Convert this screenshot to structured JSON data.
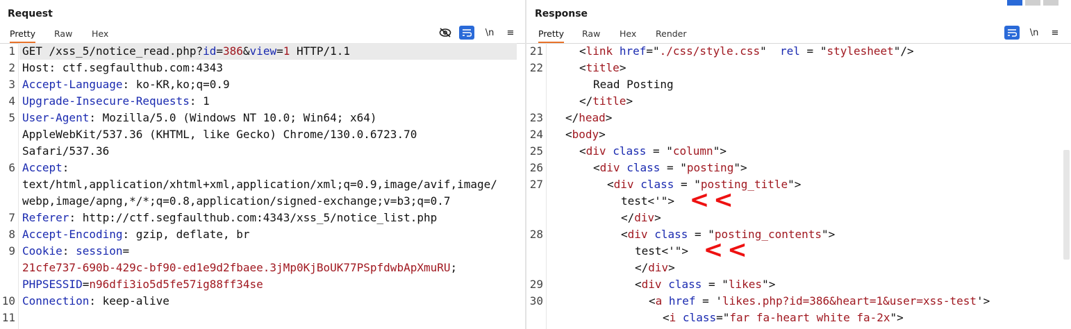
{
  "request": {
    "title": "Request",
    "tabs": [
      "Pretty",
      "Raw",
      "Hex"
    ],
    "tools": {
      "newline": "\\n",
      "menu": "≡"
    },
    "lines": [
      {
        "num": "1",
        "segments": [
          [
            "GET /xss_5/notice_read.php?",
            ""
          ],
          [
            "id",
            "k"
          ],
          [
            "=",
            ""
          ],
          [
            "386",
            "v"
          ],
          [
            "&",
            ""
          ],
          [
            "view",
            "k"
          ],
          [
            "=",
            ""
          ],
          [
            "1",
            "v"
          ],
          [
            " HTTP/1.1",
            ""
          ]
        ]
      },
      {
        "num": "2",
        "segments": [
          [
            "Host",
            ""
          ],
          [
            ": ctf.segfaulthub.com:4343",
            ""
          ]
        ]
      },
      {
        "num": "3",
        "segments": [
          [
            "Accept-Language",
            "k"
          ],
          [
            ": ko-KR,ko;q=0.9",
            ""
          ]
        ]
      },
      {
        "num": "4",
        "segments": [
          [
            "Upgrade-Insecure-Requests",
            "k"
          ],
          [
            ": 1",
            ""
          ]
        ]
      },
      {
        "num": "5",
        "segments": [
          [
            "User-Agent",
            "k"
          ],
          [
            ": Mozilla/5.0 (Windows NT 10.0; Win64; x64)",
            ""
          ]
        ]
      },
      {
        "num": "",
        "segments": [
          [
            "AppleWebKit/537.36 (KHTML, like Gecko) Chrome/130.0.6723.70",
            ""
          ]
        ]
      },
      {
        "num": "",
        "segments": [
          [
            "Safari/537.36",
            ""
          ]
        ]
      },
      {
        "num": "6",
        "segments": [
          [
            "Accept",
            "k"
          ],
          [
            ":",
            ""
          ]
        ]
      },
      {
        "num": "",
        "segments": [
          [
            "text/html,application/xhtml+xml,application/xml;q=0.9,image/avif,image/",
            ""
          ]
        ]
      },
      {
        "num": "",
        "segments": [
          [
            "webp,image/apng,*/*;q=0.8,application/signed-exchange;v=b3;q=0.7",
            ""
          ]
        ]
      },
      {
        "num": "7",
        "segments": [
          [
            "Referer",
            "k"
          ],
          [
            ": http://ctf.segfaulthub.com:4343/xss_5/notice_list.php",
            ""
          ]
        ]
      },
      {
        "num": "8",
        "segments": [
          [
            "Accept-Encoding",
            "k"
          ],
          [
            ": gzip, deflate, br",
            ""
          ]
        ]
      },
      {
        "num": "9",
        "segments": [
          [
            "Cookie",
            "k"
          ],
          [
            ": ",
            ""
          ],
          [
            "session",
            "k"
          ],
          [
            "=",
            ""
          ]
        ]
      },
      {
        "num": "",
        "segments": [
          [
            "21cfe737-690b-429c-bf90-ed1e9d2fbaee.3jMp0KjBoUK77PSpfdwbApXmuRU",
            "v"
          ],
          [
            ";",
            ""
          ]
        ]
      },
      {
        "num": "",
        "segments": [
          [
            "PHPSESSID",
            "k"
          ],
          [
            "=",
            ""
          ],
          [
            "n96dfi3io5d5fe57ig88ff34se",
            "v"
          ]
        ]
      },
      {
        "num": "10",
        "segments": [
          [
            "Connection",
            "k"
          ],
          [
            ": keep-alive",
            ""
          ]
        ]
      },
      {
        "num": "11",
        "segments": []
      }
    ]
  },
  "response": {
    "title": "Response",
    "tabs": [
      "Pretty",
      "Raw",
      "Hex",
      "Render"
    ],
    "tools": {
      "newline": "\\n",
      "menu": "≡"
    },
    "lines": [
      {
        "num": "21",
        "indent": 2,
        "segments": [
          [
            "<",
            ""
          ],
          [
            "link",
            "tg"
          ],
          [
            " ",
            ""
          ],
          [
            "href",
            "k"
          ],
          [
            "=\"",
            ""
          ],
          [
            "./css/style.css",
            "v"
          ],
          [
            "\"  ",
            ""
          ],
          [
            "rel",
            "k"
          ],
          [
            " = \"",
            ""
          ],
          [
            "stylesheet",
            "v"
          ],
          [
            "\"/>",
            ""
          ]
        ]
      },
      {
        "num": "22",
        "indent": 2,
        "segments": [
          [
            "<",
            ""
          ],
          [
            "title",
            "tg"
          ],
          [
            ">",
            ""
          ]
        ]
      },
      {
        "num": "",
        "indent": 3,
        "segments": [
          [
            "Read Posting",
            ""
          ]
        ]
      },
      {
        "num": "",
        "indent": 2,
        "segments": [
          [
            "</",
            ""
          ],
          [
            "title",
            "tg"
          ],
          [
            ">",
            ""
          ]
        ]
      },
      {
        "num": "23",
        "indent": 1,
        "segments": [
          [
            "</",
            ""
          ],
          [
            "head",
            "tg"
          ],
          [
            ">",
            ""
          ]
        ]
      },
      {
        "num": "24",
        "indent": 1,
        "segments": [
          [
            "<",
            ""
          ],
          [
            "body",
            "tg"
          ],
          [
            ">",
            ""
          ]
        ]
      },
      {
        "num": "25",
        "indent": 2,
        "segments": [
          [
            "<",
            ""
          ],
          [
            "div",
            "tg"
          ],
          [
            " ",
            ""
          ],
          [
            "class",
            "k"
          ],
          [
            " = \"",
            ""
          ],
          [
            "column",
            "v"
          ],
          [
            "\">",
            ""
          ]
        ]
      },
      {
        "num": "26",
        "indent": 3,
        "segments": [
          [
            "<",
            ""
          ],
          [
            "div",
            "tg"
          ],
          [
            " ",
            ""
          ],
          [
            "class",
            "k"
          ],
          [
            " = \"",
            ""
          ],
          [
            "posting",
            "v"
          ],
          [
            "\">",
            ""
          ]
        ]
      },
      {
        "num": "27",
        "indent": 4,
        "segments": [
          [
            "<",
            ""
          ],
          [
            "div",
            "tg"
          ],
          [
            " ",
            ""
          ],
          [
            "class",
            "k"
          ],
          [
            " = \"",
            ""
          ],
          [
            "posting_title",
            "v"
          ],
          [
            "\">",
            ""
          ]
        ]
      },
      {
        "num": "",
        "indent": 5,
        "segments": [
          [
            "test<'",
            ""
          ],
          [
            "\">",
            ""
          ]
        ],
        "arrow": "<<"
      },
      {
        "num": "",
        "indent": 5,
        "segments": [
          [
            "</",
            ""
          ],
          [
            "div",
            "tg"
          ],
          [
            ">",
            ""
          ]
        ]
      },
      {
        "num": "28",
        "indent": 5,
        "segments": [
          [
            "<",
            ""
          ],
          [
            "div",
            "tg"
          ],
          [
            " ",
            ""
          ],
          [
            "class",
            "k"
          ],
          [
            " = \"",
            ""
          ],
          [
            "posting_contents",
            "v"
          ],
          [
            "\">",
            ""
          ]
        ]
      },
      {
        "num": "",
        "indent": 6,
        "segments": [
          [
            "test<'",
            ""
          ],
          [
            "\">",
            ""
          ]
        ],
        "arrow": "<<"
      },
      {
        "num": "",
        "indent": 6,
        "segments": [
          [
            "</",
            ""
          ],
          [
            "div",
            "tg"
          ],
          [
            ">",
            ""
          ]
        ]
      },
      {
        "num": "29",
        "indent": 6,
        "segments": [
          [
            "<",
            ""
          ],
          [
            "div",
            "tg"
          ],
          [
            " ",
            ""
          ],
          [
            "class",
            "k"
          ],
          [
            " = \"",
            ""
          ],
          [
            "likes",
            "v"
          ],
          [
            "\">",
            ""
          ]
        ]
      },
      {
        "num": "30",
        "indent": 7,
        "segments": [
          [
            "<",
            ""
          ],
          [
            "a",
            "tg"
          ],
          [
            " ",
            ""
          ],
          [
            "href",
            "k"
          ],
          [
            " = '",
            ""
          ],
          [
            "likes.php?id=386&heart=1&user=xss-test",
            "v"
          ],
          [
            "'>",
            ""
          ]
        ]
      },
      {
        "num": "",
        "indent": 8,
        "segments": [
          [
            "<",
            ""
          ],
          [
            "i",
            "tg"
          ],
          [
            " ",
            ""
          ],
          [
            "class",
            "k"
          ],
          [
            "=\"",
            ""
          ],
          [
            "far fa-heart white fa-2x",
            "v"
          ],
          [
            "\">",
            ""
          ]
        ]
      }
    ]
  },
  "colors": {
    "accent_tab": "#e8732a",
    "tool_blue": "#2a6ad8",
    "arrow_red": "#e11111"
  }
}
